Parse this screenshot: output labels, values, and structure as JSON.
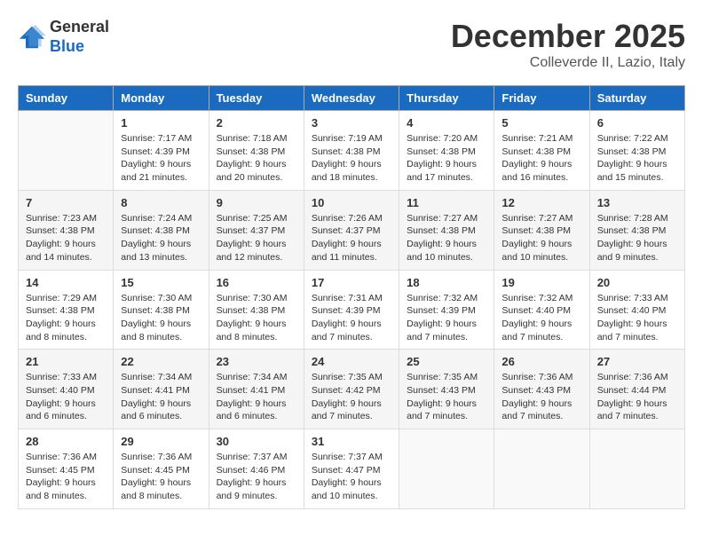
{
  "header": {
    "logo_general": "General",
    "logo_blue": "Blue",
    "month": "December 2025",
    "location": "Colleverde II, Lazio, Italy"
  },
  "weekdays": [
    "Sunday",
    "Monday",
    "Tuesday",
    "Wednesday",
    "Thursday",
    "Friday",
    "Saturday"
  ],
  "weeks": [
    [
      {
        "day": "",
        "sunrise": "",
        "sunset": "",
        "daylight": ""
      },
      {
        "day": "1",
        "sunrise": "Sunrise: 7:17 AM",
        "sunset": "Sunset: 4:39 PM",
        "daylight": "Daylight: 9 hours and 21 minutes."
      },
      {
        "day": "2",
        "sunrise": "Sunrise: 7:18 AM",
        "sunset": "Sunset: 4:38 PM",
        "daylight": "Daylight: 9 hours and 20 minutes."
      },
      {
        "day": "3",
        "sunrise": "Sunrise: 7:19 AM",
        "sunset": "Sunset: 4:38 PM",
        "daylight": "Daylight: 9 hours and 18 minutes."
      },
      {
        "day": "4",
        "sunrise": "Sunrise: 7:20 AM",
        "sunset": "Sunset: 4:38 PM",
        "daylight": "Daylight: 9 hours and 17 minutes."
      },
      {
        "day": "5",
        "sunrise": "Sunrise: 7:21 AM",
        "sunset": "Sunset: 4:38 PM",
        "daylight": "Daylight: 9 hours and 16 minutes."
      },
      {
        "day": "6",
        "sunrise": "Sunrise: 7:22 AM",
        "sunset": "Sunset: 4:38 PM",
        "daylight": "Daylight: 9 hours and 15 minutes."
      }
    ],
    [
      {
        "day": "7",
        "sunrise": "Sunrise: 7:23 AM",
        "sunset": "Sunset: 4:38 PM",
        "daylight": "Daylight: 9 hours and 14 minutes."
      },
      {
        "day": "8",
        "sunrise": "Sunrise: 7:24 AM",
        "sunset": "Sunset: 4:38 PM",
        "daylight": "Daylight: 9 hours and 13 minutes."
      },
      {
        "day": "9",
        "sunrise": "Sunrise: 7:25 AM",
        "sunset": "Sunset: 4:37 PM",
        "daylight": "Daylight: 9 hours and 12 minutes."
      },
      {
        "day": "10",
        "sunrise": "Sunrise: 7:26 AM",
        "sunset": "Sunset: 4:37 PM",
        "daylight": "Daylight: 9 hours and 11 minutes."
      },
      {
        "day": "11",
        "sunrise": "Sunrise: 7:27 AM",
        "sunset": "Sunset: 4:38 PM",
        "daylight": "Daylight: 9 hours and 10 minutes."
      },
      {
        "day": "12",
        "sunrise": "Sunrise: 7:27 AM",
        "sunset": "Sunset: 4:38 PM",
        "daylight": "Daylight: 9 hours and 10 minutes."
      },
      {
        "day": "13",
        "sunrise": "Sunrise: 7:28 AM",
        "sunset": "Sunset: 4:38 PM",
        "daylight": "Daylight: 9 hours and 9 minutes."
      }
    ],
    [
      {
        "day": "14",
        "sunrise": "Sunrise: 7:29 AM",
        "sunset": "Sunset: 4:38 PM",
        "daylight": "Daylight: 9 hours and 8 minutes."
      },
      {
        "day": "15",
        "sunrise": "Sunrise: 7:30 AM",
        "sunset": "Sunset: 4:38 PM",
        "daylight": "Daylight: 9 hours and 8 minutes."
      },
      {
        "day": "16",
        "sunrise": "Sunrise: 7:30 AM",
        "sunset": "Sunset: 4:38 PM",
        "daylight": "Daylight: 9 hours and 8 minutes."
      },
      {
        "day": "17",
        "sunrise": "Sunrise: 7:31 AM",
        "sunset": "Sunset: 4:39 PM",
        "daylight": "Daylight: 9 hours and 7 minutes."
      },
      {
        "day": "18",
        "sunrise": "Sunrise: 7:32 AM",
        "sunset": "Sunset: 4:39 PM",
        "daylight": "Daylight: 9 hours and 7 minutes."
      },
      {
        "day": "19",
        "sunrise": "Sunrise: 7:32 AM",
        "sunset": "Sunset: 4:40 PM",
        "daylight": "Daylight: 9 hours and 7 minutes."
      },
      {
        "day": "20",
        "sunrise": "Sunrise: 7:33 AM",
        "sunset": "Sunset: 4:40 PM",
        "daylight": "Daylight: 9 hours and 7 minutes."
      }
    ],
    [
      {
        "day": "21",
        "sunrise": "Sunrise: 7:33 AM",
        "sunset": "Sunset: 4:40 PM",
        "daylight": "Daylight: 9 hours and 6 minutes."
      },
      {
        "day": "22",
        "sunrise": "Sunrise: 7:34 AM",
        "sunset": "Sunset: 4:41 PM",
        "daylight": "Daylight: 9 hours and 6 minutes."
      },
      {
        "day": "23",
        "sunrise": "Sunrise: 7:34 AM",
        "sunset": "Sunset: 4:41 PM",
        "daylight": "Daylight: 9 hours and 6 minutes."
      },
      {
        "day": "24",
        "sunrise": "Sunrise: 7:35 AM",
        "sunset": "Sunset: 4:42 PM",
        "daylight": "Daylight: 9 hours and 7 minutes."
      },
      {
        "day": "25",
        "sunrise": "Sunrise: 7:35 AM",
        "sunset": "Sunset: 4:43 PM",
        "daylight": "Daylight: 9 hours and 7 minutes."
      },
      {
        "day": "26",
        "sunrise": "Sunrise: 7:36 AM",
        "sunset": "Sunset: 4:43 PM",
        "daylight": "Daylight: 9 hours and 7 minutes."
      },
      {
        "day": "27",
        "sunrise": "Sunrise: 7:36 AM",
        "sunset": "Sunset: 4:44 PM",
        "daylight": "Daylight: 9 hours and 7 minutes."
      }
    ],
    [
      {
        "day": "28",
        "sunrise": "Sunrise: 7:36 AM",
        "sunset": "Sunset: 4:45 PM",
        "daylight": "Daylight: 9 hours and 8 minutes."
      },
      {
        "day": "29",
        "sunrise": "Sunrise: 7:36 AM",
        "sunset": "Sunset: 4:45 PM",
        "daylight": "Daylight: 9 hours and 8 minutes."
      },
      {
        "day": "30",
        "sunrise": "Sunrise: 7:37 AM",
        "sunset": "Sunset: 4:46 PM",
        "daylight": "Daylight: 9 hours and 9 minutes."
      },
      {
        "day": "31",
        "sunrise": "Sunrise: 7:37 AM",
        "sunset": "Sunset: 4:47 PM",
        "daylight": "Daylight: 9 hours and 10 minutes."
      },
      {
        "day": "",
        "sunrise": "",
        "sunset": "",
        "daylight": ""
      },
      {
        "day": "",
        "sunrise": "",
        "sunset": "",
        "daylight": ""
      },
      {
        "day": "",
        "sunrise": "",
        "sunset": "",
        "daylight": ""
      }
    ]
  ]
}
